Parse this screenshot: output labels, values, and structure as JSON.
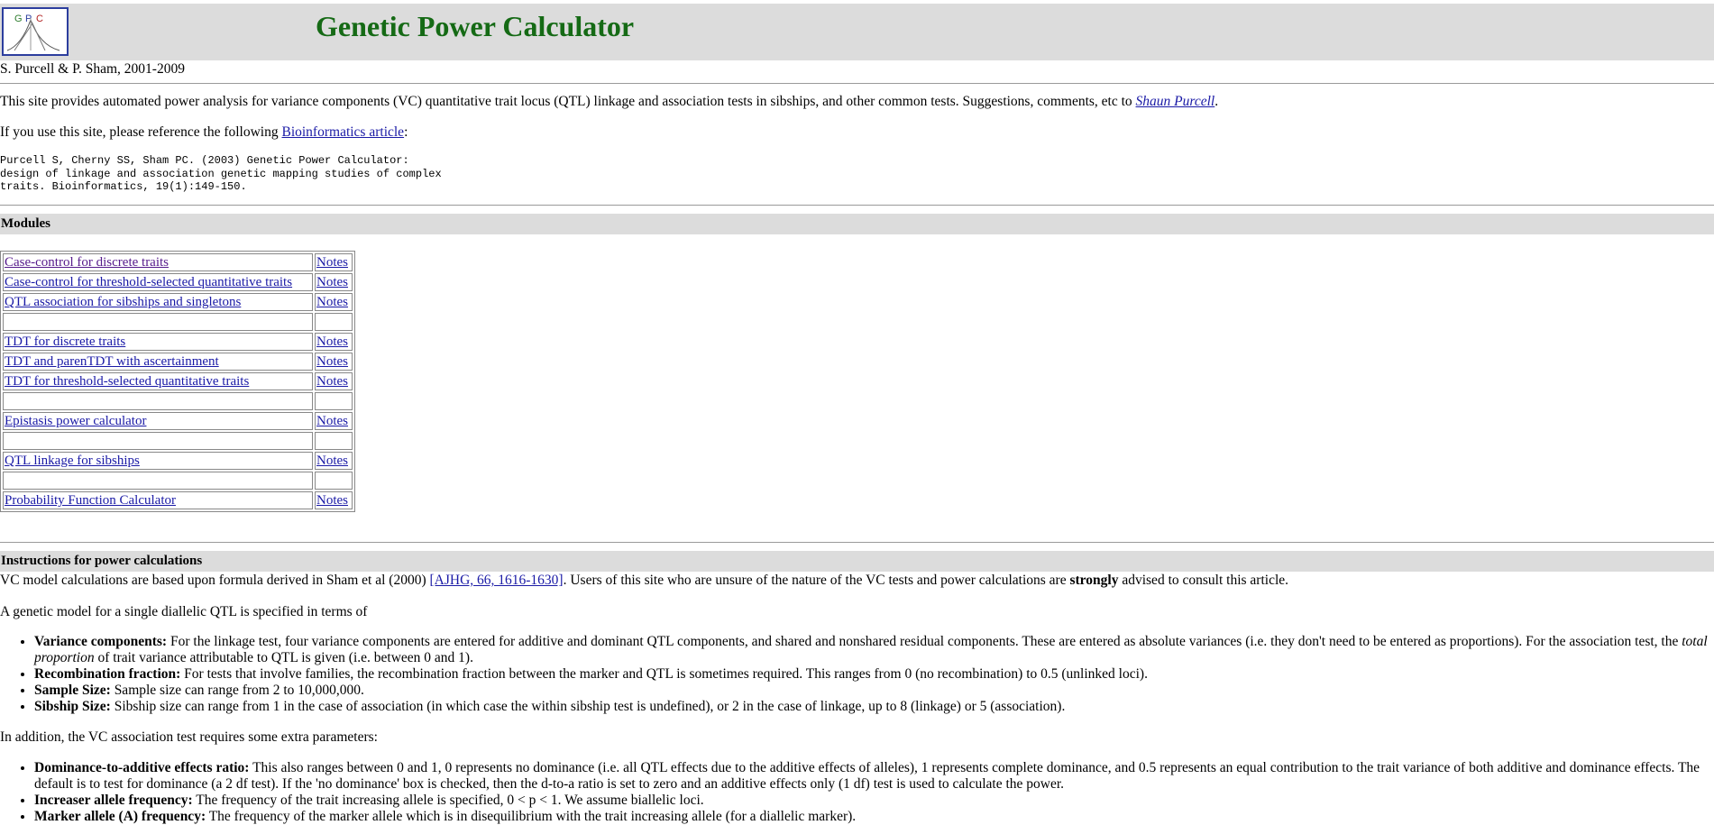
{
  "header": {
    "logo_text": "GPC",
    "title": "Genetic Power Calculator"
  },
  "authors": "S. Purcell & P. Sham, 2001-2009",
  "intro": {
    "text": "This site provides automated power analysis for variance components (VC) quantitative trait locus (QTL) linkage and association tests in sibships, and other common tests. Suggestions, comments, etc to ",
    "contact_link": "Shaun Purcell",
    "end": "."
  },
  "reference": {
    "text": "If you use this site, please reference the following ",
    "link": "Bioinformatics article",
    "end": ":",
    "citation": "Purcell S, Cherny SS, Sham PC. (2003) Genetic Power Calculator:\ndesign of linkage and association genetic mapping studies of complex\ntraits. Bioinformatics, 19(1):149-150."
  },
  "modules": {
    "heading": "Modules",
    "notes_label": "Notes",
    "rows": [
      {
        "name": "Case-control for discrete traits",
        "notes": true
      },
      {
        "name": "Case-control for threshold-selected quantitative traits",
        "notes": true
      },
      {
        "name": "QTL association for sibships and singletons",
        "notes": true
      },
      {
        "name": "",
        "notes": false
      },
      {
        "name": "TDT for discrete traits",
        "notes": true
      },
      {
        "name": "TDT and parenTDT with ascertainment",
        "notes": true
      },
      {
        "name": "TDT for threshold-selected quantitative traits",
        "notes": true
      },
      {
        "name": "",
        "notes": false
      },
      {
        "name": "Epistasis power calculator",
        "notes": true
      },
      {
        "name": "",
        "notes": false
      },
      {
        "name": "QTL linkage for sibships",
        "notes": true
      },
      {
        "name": "",
        "notes": false
      },
      {
        "name": "Probability Function Calculator",
        "notes": true
      }
    ]
  },
  "instructions": {
    "heading": "Instructions for power calculations",
    "para1_a": "VC model calculations are based upon formula derived in Sham et al (2000) ",
    "para1_link": "[AJHG, 66, 1616-1630]",
    "para1_b": ". Users of this site who are unsure of the nature of the VC tests and power calculations are ",
    "para1_strong": "strongly",
    "para1_c": " advised to consult this article.",
    "para2": "A genetic model for a single diallelic QTL is specified in terms of",
    "list1": [
      {
        "term": "Variance components:",
        "a": " For the linkage test, four variance components are entered for additive and dominant QTL components, and shared and nonshared residual components. These are entered as absolute variances (i.e. they don't need to be entered as proportions). For the association test, the ",
        "em": "total proportion",
        "b": " of trait variance attributable to QTL is given (i.e. between 0 and 1)."
      },
      {
        "term": "Recombination fraction:",
        "a": " For tests that involve families, the recombination fraction between the marker and QTL is sometimes required. This ranges from 0 (no recombination) to 0.5 (unlinked loci).",
        "em": "",
        "b": ""
      },
      {
        "term": "Sample Size:",
        "a": " Sample size can range from 2 to 10,000,000.",
        "em": "",
        "b": ""
      },
      {
        "term": "Sibship Size:",
        "a": " Sibship size can range from 1 in the case of association (in which case the within sibship test is undefined), or 2 in the case of linkage, up to 8 (linkage) or 5 (association).",
        "em": "",
        "b": ""
      }
    ],
    "para3": "In addition, the VC association test requires some extra parameters:",
    "list2": [
      {
        "term": "Dominance-to-additive effects ratio:",
        "a": " This also ranges between 0 and 1, 0 represents no dominance (i.e. all QTL effects due to the additive effects of alleles), 1 represents complete dominance, and 0.5 represents an equal contribution to the trait variance of both additive and dominance effects. The default is to test for dominance (a 2 df test). If the 'no dominance' box is checked, then the d-to-a ratio is set to zero and an additive effects only (1 df) test is used to calculate the power.",
        "em": "",
        "b": ""
      },
      {
        "term": "Increaser allele frequency:",
        "a": " The frequency of the trait increasing allele is specified, 0 < p < 1. We assume biallelic loci.",
        "em": "",
        "b": ""
      },
      {
        "term": "Marker allele (A) frequency:",
        "a": " The frequency of the marker allele which is in disequilibrium with the trait increasing allele (for a diallelic marker).",
        "em": "",
        "b": ""
      }
    ]
  }
}
